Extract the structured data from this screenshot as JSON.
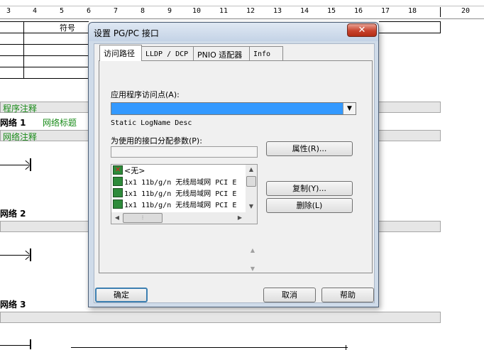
{
  "ruler": {
    "numbers": [
      "3",
      "4",
      "5",
      "6",
      "7",
      "8",
      "9",
      "10",
      "11",
      "12",
      "13",
      "14",
      "15",
      "16",
      "17",
      "18",
      "20"
    ]
  },
  "editor": {
    "symbol_header": "符号",
    "program_comment": "程序注释",
    "networks": [
      {
        "title": "网络 1",
        "network_title_label": "网络标题",
        "comment_label": "网络注释"
      },
      {
        "title": "网络 2"
      },
      {
        "title": "网络 3"
      }
    ]
  },
  "dialog": {
    "title": "设置 PG/PC 接口",
    "close_symbol": "✕",
    "tabs": [
      "访问路径",
      "LLDP / DCP",
      "PNIO 适配器",
      "Info"
    ],
    "access_point_label": "应用程序访问点(A):",
    "access_point_value": "",
    "access_point_desc": "Static LogName Desc",
    "interface_param_label": "为使用的接口分配参数(P):",
    "interface_param_value": "",
    "interface_list": [
      {
        "label": "<无>",
        "icon": "none-adapter-icon"
      },
      {
        "label": "1x1 11b/g/n 无线局域网 PCI E",
        "icon": "network-adapter-icon"
      },
      {
        "label": "1x1 11b/g/n 无线局域网 PCI E",
        "icon": "network-adapter-icon"
      },
      {
        "label": "1x1 11b/g/n 无线局域网 PCI E",
        "icon": "network-adapter-icon"
      }
    ],
    "buttons": {
      "properties": "属性(R)...",
      "copy": "复制(Y)...",
      "delete": "删除(L)",
      "ok": "确定",
      "cancel": "取消",
      "help": "帮助"
    }
  },
  "colors": {
    "selection_blue": "#3399ff",
    "comment_green": "#1a8c1a",
    "close_red": "#c7432e"
  }
}
